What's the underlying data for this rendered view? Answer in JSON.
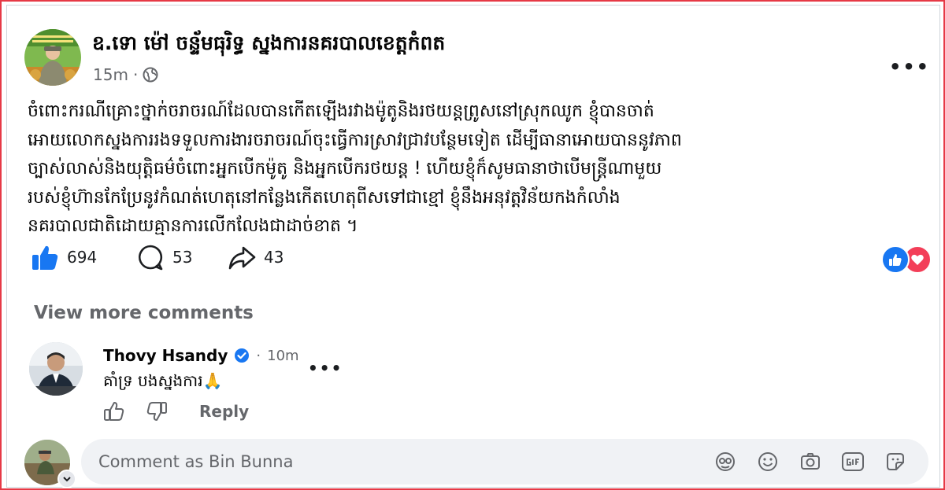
{
  "post": {
    "author": "ឧ.ទោ ម៉ៅ ចន្ទ័មធុរិទ្ធ ស្នងការនគរបាលខេត្តកំពត",
    "time": "15m",
    "lines": [
      "ចំពោះករណីគ្រោះថ្នាក់ចរាចរណ៍ដែលបានកើតឡើងរវាងម៉ូតូនិងរថយន្តព្រូសនៅស្រុកឈូក ខ្ញុំបានចាត់",
      "អោយលោកស្នងការរងទទួលការងារចរាចរណ៍ចុះធ្វើការស្រាវជ្រាវបន្ថែមទៀត ដើម្បីធានាអោយបាននូវភាព",
      "ច្បាស់លាស់និងយុត្តិធម៌ចំពោះអ្នកបើកម៉ូតូ និងអ្នកបើករថយន្ត ! ហើយខ្ញុំក៏សូមធានាថាបើមន្ត្រីណាមួយ",
      "របស់ខ្ញុំហ៊ានកែប្រែនូវកំណត់ហេតុនៅកន្លែងកើតហេតុពីសទៅជាខ្មៅ ខ្ញុំនឹងអនុវត្តវិន័យកងកំលាំង",
      "នគរបាលជាតិដោយគ្មានការលើកលែងជាដាច់ខាត ។"
    ],
    "likes": "694",
    "comments": "53",
    "shares": "43"
  },
  "view_more": "View more comments",
  "comment": {
    "author": "Thovy Hsandy",
    "time": "10m",
    "text": "គាំទ្រ បងស្នងការ🙏",
    "reply": "Reply"
  },
  "composer": {
    "placeholder": "Comment as Bin Bunna"
  },
  "colors": {
    "like_blue": "#1877f2",
    "love_red": "#f33e58",
    "verified_blue": "#1877f2",
    "meta_gray": "#65676b",
    "input_bg": "#f0f2f5"
  },
  "icons": [
    "globe-icon",
    "more-icon",
    "like-icon",
    "comment-icon",
    "share-icon",
    "like-badge-icon",
    "love-badge-icon",
    "verified-icon",
    "thumbs-up-icon",
    "thumbs-down-icon",
    "chevron-down-icon",
    "avatar-sticker-icon",
    "emoji-icon",
    "camera-icon",
    "gif-icon",
    "sticker-icon"
  ]
}
